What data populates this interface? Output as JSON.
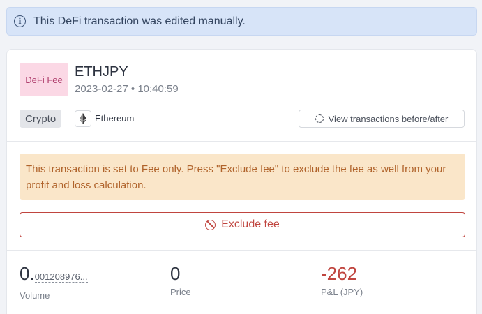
{
  "banner": {
    "icon": "info-icon",
    "text": "This DeFi transaction was edited manually."
  },
  "transaction": {
    "badge": "DeFi Fee",
    "pair": "ETHJPY",
    "datetime": "2023-02-27 • 10:40:59",
    "tag": "Crypto",
    "chain_icon": "ethereum-icon",
    "chain": "Ethereum",
    "view_button": "View transactions before/after"
  },
  "warning": {
    "text": "This transaction is set to Fee only. Press \"Exclude fee\" to exclude the fee as well from your profit and loss calculation."
  },
  "exclude_button": {
    "icon": "ban-icon",
    "label": "Exclude fee"
  },
  "stats": {
    "volume": {
      "int": "0.",
      "decimals": "001208976...",
      "label": "Volume"
    },
    "price": {
      "value": "0",
      "label": "Price"
    },
    "pl": {
      "value": "-262",
      "label": "P&L (JPY)"
    }
  },
  "colors": {
    "banner_bg": "#d7e4f8",
    "badge_bg": "#fbd8e5",
    "warning_bg": "#fae6c9",
    "negative": "#c0453f"
  }
}
